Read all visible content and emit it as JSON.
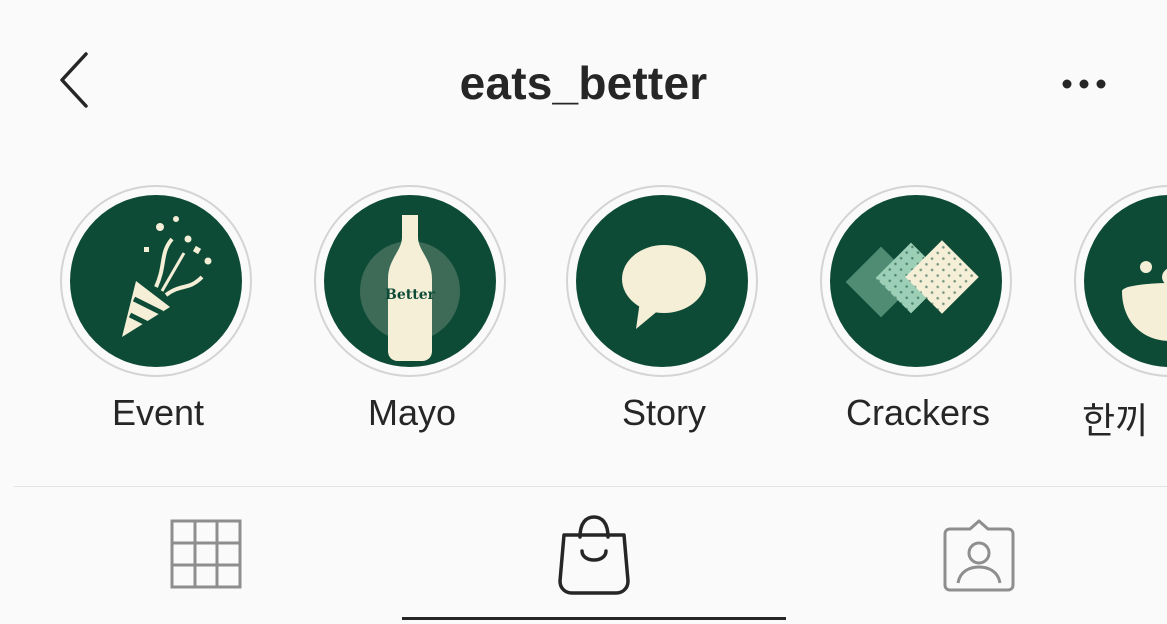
{
  "header": {
    "title": "eats_better",
    "back_icon": "chevron-left-icon",
    "more_icon": "more-horizontal-icon"
  },
  "highlights": [
    {
      "label": "Event",
      "icon": "party-popper-icon"
    },
    {
      "label": "Mayo",
      "icon": "mayo-bottle-icon",
      "bottle_text": "Better"
    },
    {
      "label": "Story",
      "icon": "speech-bubble-icon"
    },
    {
      "label": "Crackers",
      "icon": "crackers-icon"
    },
    {
      "label": "한끼",
      "icon": "bowl-icon"
    }
  ],
  "tabs": [
    {
      "name": "grid",
      "icon": "grid-icon",
      "active": false
    },
    {
      "name": "shop",
      "icon": "shopping-bag-icon",
      "active": true
    },
    {
      "name": "tagged",
      "icon": "tagged-user-icon",
      "active": false
    }
  ],
  "colors": {
    "highlight_bg": "#0d4b37",
    "highlight_fg": "#f4efd6",
    "text": "#262626",
    "background": "#fafafa"
  }
}
